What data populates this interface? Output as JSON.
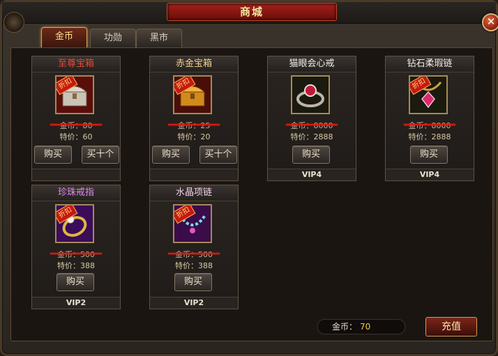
{
  "window": {
    "title": "商城",
    "close": "✕"
  },
  "tabs": [
    {
      "label": "金币",
      "active": true
    },
    {
      "label": "功勋",
      "active": false
    },
    {
      "label": "黑市",
      "active": false
    }
  ],
  "items": [
    {
      "name": "至尊宝箱",
      "icon": "treasure-chest-silver-icon",
      "discount": "折扣",
      "old_price": "金币：80",
      "sale_price": "特价：60",
      "buttons": [
        "购买",
        "买十个"
      ],
      "vip": ""
    },
    {
      "name": "赤金宝箱",
      "icon": "treasure-chest-gold-icon",
      "discount": "折扣",
      "old_price": "金币：25",
      "sale_price": "特价：20",
      "buttons": [
        "购买",
        "买十个"
      ],
      "vip": ""
    },
    {
      "name": "猫眼会心戒",
      "icon": "ruby-ring-icon",
      "discount": "",
      "old_price": "金币：8000",
      "sale_price": "特价：2888",
      "buttons": [
        "购买"
      ],
      "vip": "VIP4"
    },
    {
      "name": "钻石柔瑕链",
      "icon": "diamond-necklace-icon",
      "discount": "折扣",
      "old_price": "金币：8000",
      "sale_price": "特价：2888",
      "buttons": [
        "购买"
      ],
      "vip": "VIP4"
    },
    {
      "name": "珍珠戒指",
      "icon": "pearl-ring-icon",
      "discount": "折扣",
      "old_price": "金币：500",
      "sale_price": "特价：388",
      "buttons": [
        "购买"
      ],
      "vip": "VIP2"
    },
    {
      "name": "水晶项链",
      "icon": "crystal-necklace-icon",
      "discount": "折扣",
      "old_price": "金币：500",
      "sale_price": "特价：388",
      "buttons": [
        "购买"
      ],
      "vip": "VIP2"
    }
  ],
  "footer": {
    "gold_label": "金币：",
    "gold_value": "70",
    "recharge_label": "充值"
  },
  "colors": {
    "accent_red": "#a3201a",
    "gold": "#f3c84a",
    "strike": "#d41d10"
  }
}
